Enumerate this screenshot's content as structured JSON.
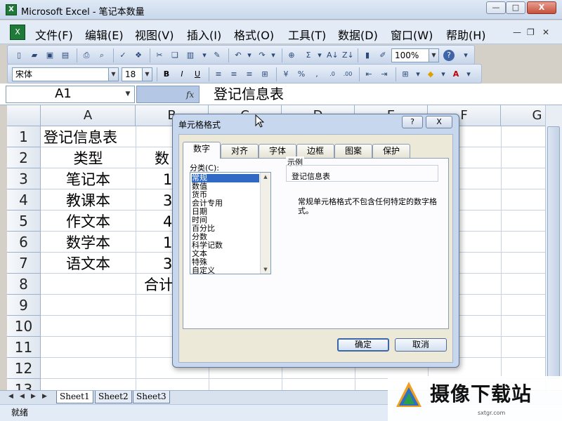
{
  "window": {
    "title": "Microsoft Excel - 笔记本数量",
    "min": "—",
    "max": "□",
    "close": "X"
  },
  "menu": [
    "文件(F)",
    "编辑(E)",
    "视图(V)",
    "插入(I)",
    "格式(O)",
    "工具(T)",
    "数据(D)",
    "窗口(W)",
    "帮助(H)"
  ],
  "toolbar": {
    "zoom": "100%",
    "font": "宋体",
    "size": "18"
  },
  "formula": {
    "cell_ref": "A1",
    "fx": "fx",
    "content": "登记信息表"
  },
  "columns": [
    "A",
    "B",
    "C",
    "D",
    "E",
    "F",
    "G"
  ],
  "rows": [
    "1",
    "2",
    "3",
    "4",
    "5",
    "6",
    "7",
    "8",
    "9",
    "10",
    "11",
    "12",
    "13"
  ],
  "cells": {
    "a1": "登记信息表",
    "a2": "类型",
    "b2": "数",
    "a3": "笔记本",
    "b3": "1",
    "a4": "教课本",
    "b4": "3",
    "a5": "作文本",
    "b5": "4",
    "a6": "数学本",
    "b6": "1",
    "a7": "语文本",
    "b7": "3",
    "b8": "合计"
  },
  "sheets": [
    "Sheet1",
    "Sheet2",
    "Sheet3"
  ],
  "status": "就绪",
  "dialog": {
    "title": "单元格格式",
    "help": "?",
    "close": "X",
    "tabs": [
      "数字",
      "对齐",
      "字体",
      "边框",
      "图案",
      "保护"
    ],
    "category_label": "分类(C):",
    "categories": [
      "常规",
      "数值",
      "货币",
      "会计专用",
      "日期",
      "时间",
      "百分比",
      "分数",
      "科学记数",
      "文本",
      "特殊",
      "自定义"
    ],
    "selected_category": "常规",
    "sample_label": "示例",
    "sample_value": "登记信息表",
    "description": "常规单元格格式不包含任何特定的数字格式。",
    "ok": "确定",
    "cancel": "取消"
  },
  "watermark": {
    "text": "摄像下载站",
    "url": "sxtgr.com"
  }
}
